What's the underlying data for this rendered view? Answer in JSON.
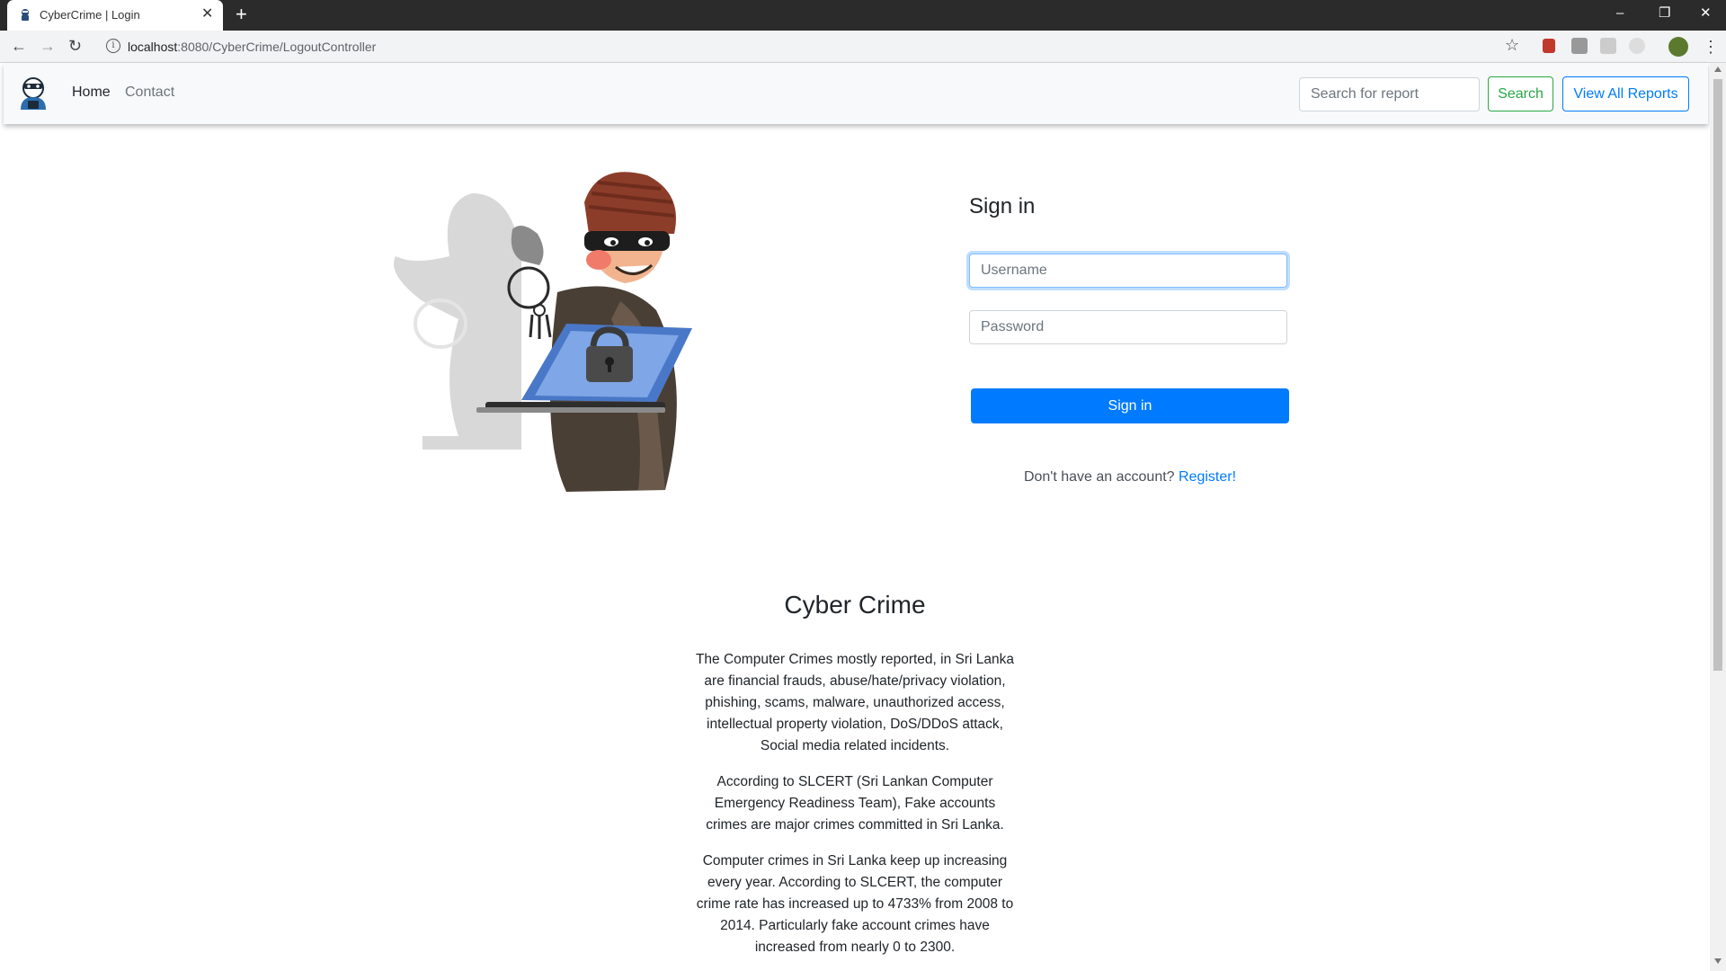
{
  "browser": {
    "tab_title": "CyberCrime | Login",
    "url_host": "localhost",
    "url_path": ":8080/CyberCrime/LogoutController"
  },
  "navbar": {
    "home_label": "Home",
    "contact_label": "Contact",
    "search_placeholder": "Search for report",
    "search_button": "Search",
    "view_all_button": "View All Reports"
  },
  "signin": {
    "title": "Sign in",
    "username_placeholder": "Username",
    "password_placeholder": "Password",
    "submit_label": "Sign in",
    "register_prompt": "Don't have an account?",
    "register_link": "Register!"
  },
  "about": {
    "title": "Cyber Crime",
    "paragraphs": [
      "The Computer Crimes mostly reported, in Sri Lanka are financial frauds, abuse/hate/privacy violation, phishing, scams, malware, unauthorized access, intellectual property violation, DoS/DDoS attack, Social media related incidents.",
      "According to SLCERT (Sri Lankan Computer Emergency Readiness Team), Fake accounts crimes are major crimes committed in Sri Lanka.",
      "Computer crimes in Sri Lanka keep up increasing every year. According to SLCERT, the computer crime rate has increased up to 4733% from 2008 to 2014. Particularly fake account crimes have increased from nearly 0 to 2300."
    ]
  },
  "colors": {
    "primary": "#007bff",
    "success": "#28a745",
    "navbar_bg": "#f8f9fa"
  },
  "icons": {
    "brand": "hacker-logo-icon",
    "illustration": "thief-with-laptop-illustration"
  }
}
